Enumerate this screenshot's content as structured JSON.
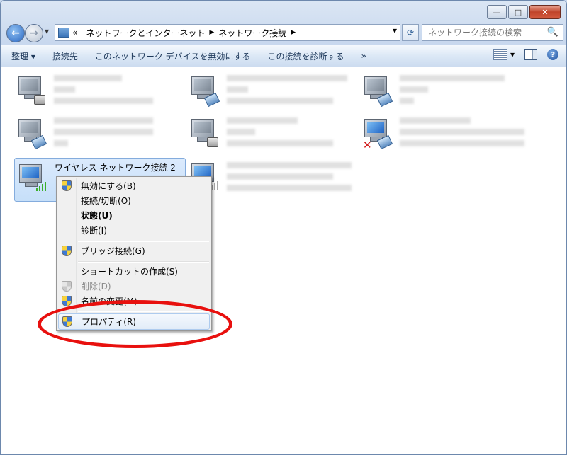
{
  "caption": {
    "minimize": "—",
    "maximize": "□",
    "close": "✕"
  },
  "nav": {
    "back": "←",
    "forward": "→",
    "dropdown": "▼"
  },
  "address": {
    "overflow": "«",
    "crumbs": [
      "ネットワークとインターネット",
      "ネットワーク接続"
    ],
    "separator": "▶",
    "dropdown": "▼"
  },
  "refresh": "⟳",
  "search": {
    "placeholder": "ネットワーク接続の検索",
    "icon": "🔍"
  },
  "toolbar": {
    "organize": "整理 ▾",
    "connect_to": "接続先",
    "disable_device": "このネットワーク デバイスを無効にする",
    "diagnose": "この接続を診断する",
    "more": "»",
    "view_dropdown": "▾",
    "help": "?"
  },
  "selected_connection": {
    "title": "ワイヤレス ネットワーク接続 2"
  },
  "context_menu": {
    "items": [
      {
        "label": "無効にする(B)",
        "icon": "uac-shield-icon"
      },
      {
        "label": "接続/切断(O)",
        "icon": ""
      },
      {
        "label": "状態(U)",
        "icon": "",
        "bold": true
      },
      {
        "label": "診断(I)",
        "icon": ""
      },
      {
        "label": "ブリッジ接続(G)",
        "icon": "uac-shield-icon"
      },
      {
        "label": "ショートカットの作成(S)",
        "icon": ""
      },
      {
        "label": "削除(D)",
        "icon": "uac-shield-icon",
        "disabled": true
      },
      {
        "label": "名前の変更(M)",
        "icon": "uac-shield-icon"
      },
      {
        "label": "プロパティ(R)",
        "icon": "uac-shield-icon",
        "highlighted": true
      }
    ]
  },
  "annotation": {
    "color": "#e8100e"
  }
}
